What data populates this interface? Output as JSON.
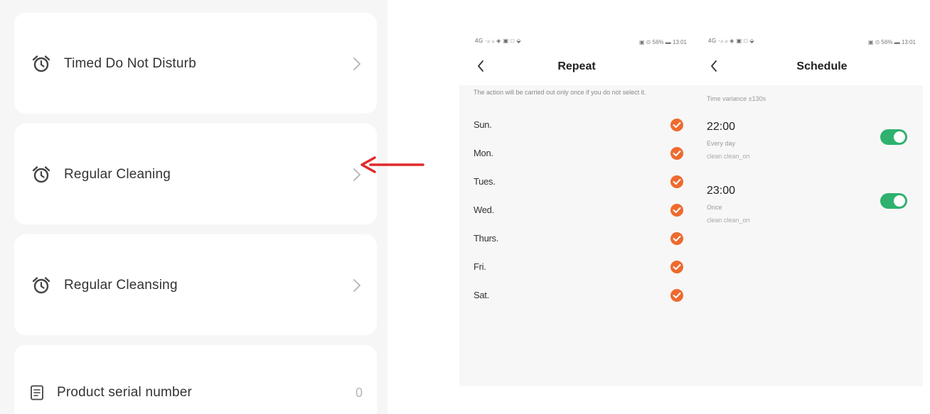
{
  "settings_list": {
    "items": [
      {
        "label": "Timed Do Not Disturb",
        "icon": "alarm-clock-icon"
      },
      {
        "label": "Regular Cleaning",
        "icon": "alarm-clock-icon"
      },
      {
        "label": "Regular Cleansing",
        "icon": "alarm-clock-icon"
      }
    ],
    "serial": {
      "label": "Product serial number",
      "value": "0",
      "icon": "document-icon"
    }
  },
  "repeat_screen": {
    "status_left": "4G ·ᵢₗ ᵢₗ ◈ ▣ □ ⬙",
    "status_right": "▣ ⊙ 56% ▬ 13:01",
    "title": "Repeat",
    "note": "The action will be carried out only once if you do not select it.",
    "days": [
      {
        "label": "Sun.",
        "checked": true
      },
      {
        "label": "Mon.",
        "checked": true
      },
      {
        "label": "Tues.",
        "checked": true
      },
      {
        "label": "Wed.",
        "checked": true
      },
      {
        "label": "Thurs.",
        "checked": true
      },
      {
        "label": "Fri.",
        "checked": true
      },
      {
        "label": "Sat.",
        "checked": true
      }
    ]
  },
  "schedule_screen": {
    "status_left": "4G ·ᵢₗ ᵢₗ ◈ ▣ □ ⬙",
    "status_right": "▣ ⊙ 56% ▬ 13:01",
    "title": "Schedule",
    "time_note": "Time variance ±130s",
    "schedules": [
      {
        "time": "22:00",
        "repeat": "Every day",
        "mode": "clean clean_on",
        "enabled": true
      },
      {
        "time": "23:00",
        "repeat": "Once",
        "mode": "clean clean_on",
        "enabled": true
      }
    ]
  },
  "colors": {
    "accent_check": "#ef6a2e",
    "toggle_on": "#2fb26d",
    "arrow": "#e02a2a"
  }
}
